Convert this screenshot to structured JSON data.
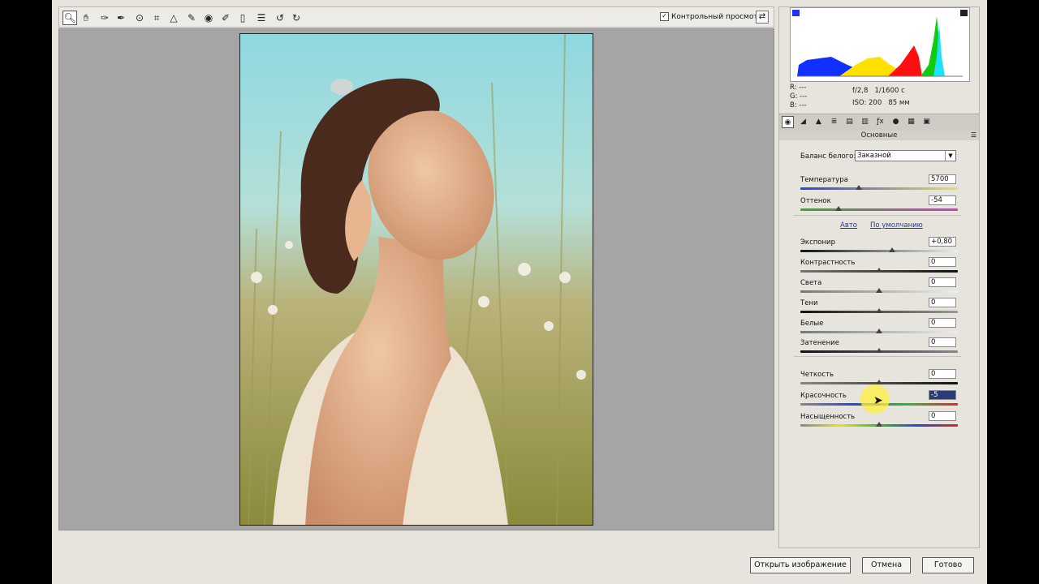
{
  "toolbar": {
    "tools": [
      {
        "icon": "zoom-icon",
        "glyph": "🔍︎",
        "active": true
      },
      {
        "icon": "hand-icon",
        "glyph": "✋︎"
      },
      {
        "icon": "white-balance-eyedropper-icon",
        "glyph": "✑"
      },
      {
        "icon": "color-sampler-icon",
        "glyph": "✒"
      },
      {
        "icon": "targeted-adjustment-icon",
        "glyph": "⊙"
      },
      {
        "icon": "crop-icon",
        "glyph": "⌗"
      },
      {
        "icon": "straighten-icon",
        "glyph": "△"
      },
      {
        "icon": "spot-removal-icon",
        "glyph": "✎"
      },
      {
        "icon": "red-eye-icon",
        "glyph": "◉"
      },
      {
        "icon": "adjustment-brush-icon",
        "glyph": "✐"
      },
      {
        "icon": "graduated-filter-icon",
        "glyph": "▯"
      },
      {
        "icon": "preferences-icon",
        "glyph": "☰"
      },
      {
        "icon": "rotate-left-icon",
        "glyph": "↺"
      },
      {
        "icon": "rotate-right-icon",
        "glyph": "↻"
      }
    ],
    "preview_label": "Контрольный просмотр",
    "preview_checked": "✓"
  },
  "histogram": {
    "readout_rgb": {
      "r": "R:  ---",
      "g": "G:  ---",
      "b": "B:  ---"
    },
    "aperture": "f/2,8",
    "shutter": "1/1600 с",
    "iso": "ISO: 200",
    "focal": "85 мм"
  },
  "panel": {
    "section_title": "Основные",
    "white_balance_label": "Баланс белого:",
    "white_balance_value": "Заказной",
    "auto_link": "Авто",
    "default_link": "По умолчанию",
    "sliders": [
      {
        "key": "temperature",
        "label": "Температура",
        "value": "5700",
        "pos": 0.37
      },
      {
        "key": "tint",
        "label": "Оттенок",
        "value": "-54",
        "pos": 0.24
      },
      {
        "key": "exposure",
        "label": "Экспонир",
        "value": "+0,80",
        "pos": 0.58
      },
      {
        "key": "contrast",
        "label": "Контрастность",
        "value": "0",
        "pos": 0.5
      },
      {
        "key": "highlights",
        "label": "Света",
        "value": "0",
        "pos": 0.5
      },
      {
        "key": "shadows",
        "label": "Тени",
        "value": "0",
        "pos": 0.5
      },
      {
        "key": "whites",
        "label": "Белые",
        "value": "0",
        "pos": 0.5
      },
      {
        "key": "blacks",
        "label": "Затенение",
        "value": "0",
        "pos": 0.5
      },
      {
        "key": "clarity",
        "label": "Четкость",
        "value": "0",
        "pos": 0.5
      },
      {
        "key": "vibrance",
        "label": "Красочность",
        "value": "-5",
        "pos": 0.49
      },
      {
        "key": "saturation",
        "label": "Насыщенность",
        "value": "0",
        "pos": 0.5
      }
    ]
  },
  "buttons": {
    "open": "Открыть изображение",
    "cancel": "Отмена",
    "done": "Готово"
  },
  "colors": {
    "link": "#1f3aa6",
    "selection": "#2a3b78"
  }
}
